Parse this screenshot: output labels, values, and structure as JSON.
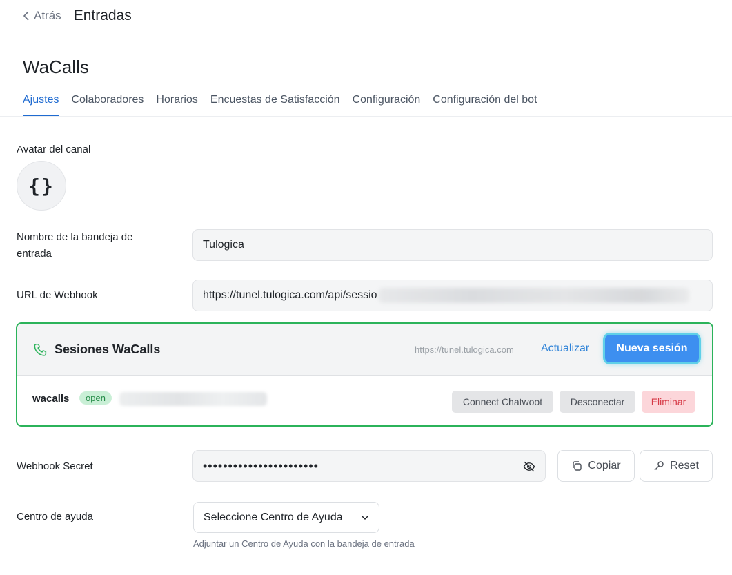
{
  "header": {
    "back_label": "Atrás",
    "title": "Entradas"
  },
  "inbox": {
    "name": "WaCalls"
  },
  "tabs": [
    {
      "label": "Ajustes",
      "active": true
    },
    {
      "label": "Colaboradores",
      "active": false
    },
    {
      "label": "Horarios",
      "active": false
    },
    {
      "label": "Encuestas de Satisfacción",
      "active": false
    },
    {
      "label": "Configuración",
      "active": false
    },
    {
      "label": "Configuración del bot",
      "active": false
    }
  ],
  "avatar": {
    "label": "Avatar del canal",
    "glyph": "{}"
  },
  "inbox_name_field": {
    "label": "Nombre de la bandeja de entrada",
    "value": "Tulogica"
  },
  "webhook_url_field": {
    "label": "URL de Webhook",
    "value": "https://tunel.tulogica.com/api/sessio"
  },
  "sessions": {
    "title": "Sesiones WaCalls",
    "url": "https://tunel.tulogica.com",
    "refresh_label": "Actualizar",
    "new_session_label": "Nueva sesión",
    "items": [
      {
        "name": "wacalls",
        "status": "open",
        "connect_label": "Connect Chatwoot",
        "disconnect_label": "Desconectar",
        "delete_label": "Eliminar"
      }
    ]
  },
  "webhook_secret": {
    "label": "Webhook Secret",
    "masked_value": "•••••••••••••••••••••••",
    "copy_label": "Copiar",
    "reset_label": "Reset"
  },
  "help_center": {
    "label": "Centro de ayuda",
    "selected": "Seleccione Centro de Ayuda",
    "help_text": "Adjuntar un Centro de Ayuda con la bandeja de entrada"
  },
  "colors": {
    "accent": "#1f6bd1",
    "card_border": "#2bb35a",
    "primary_button": "#3d8ff0",
    "status_open_bg": "#c9efd6",
    "danger": "#d63845"
  },
  "icons": {
    "back": "chevron-left-icon",
    "phone": "phone-icon",
    "eye": "eye-off-icon",
    "copy": "copy-icon",
    "key": "key-icon",
    "dropdown": "chevron-down-icon"
  }
}
